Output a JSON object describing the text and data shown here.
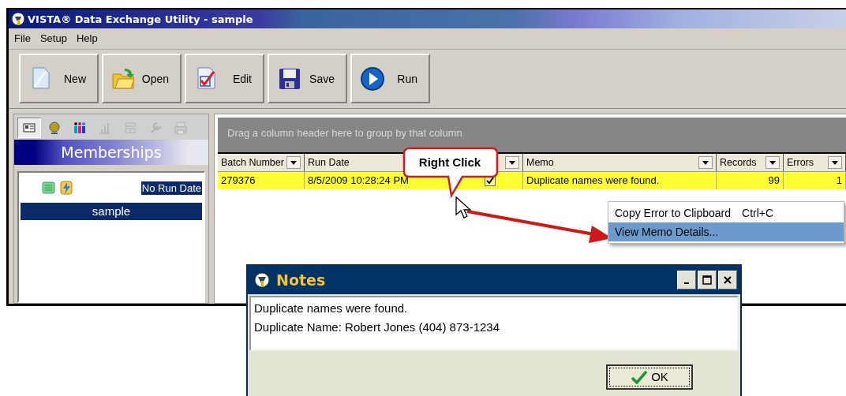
{
  "window": {
    "title": "VISTA® Data Exchange Utility - sample"
  },
  "menu": [
    "File",
    "Setup",
    "Help"
  ],
  "toolbar": [
    {
      "label": "New",
      "kind": "new"
    },
    {
      "label": "Open",
      "kind": "open"
    },
    {
      "label": "Edit",
      "kind": "edit"
    },
    {
      "label": "Save",
      "kind": "save"
    },
    {
      "label": "Run",
      "kind": "run"
    }
  ],
  "nav_tabs": [
    {
      "kind": "card",
      "selected": true,
      "disabled": false
    },
    {
      "kind": "head",
      "selected": false,
      "disabled": false
    },
    {
      "kind": "people",
      "selected": false,
      "disabled": false
    },
    {
      "kind": "chart",
      "selected": false,
      "disabled": true
    },
    {
      "kind": "grid",
      "selected": false,
      "disabled": true
    },
    {
      "kind": "tool",
      "selected": false,
      "disabled": true
    },
    {
      "kind": "printer",
      "selected": false,
      "disabled": true
    }
  ],
  "panel_title": "Memberships",
  "memberships": [
    {
      "kind": "status",
      "label": "No Run Date",
      "selected": true
    },
    {
      "kind": "name",
      "label": "sample",
      "selected": true
    }
  ],
  "grid": {
    "group_hint": "Drag a column header here to group by that column",
    "columns": [
      {
        "label": "Batch Number"
      },
      {
        "label": "Run Date"
      },
      {},
      {
        "label": "Memo"
      },
      {
        "label": "Records"
      },
      {
        "label": "Errors"
      }
    ],
    "rows": [
      {
        "selected": true,
        "batch": "279376",
        "run_date": "8/5/2009 10:28:24 PM",
        "checked": true,
        "memo": "Duplicate names were found.",
        "records": "99",
        "errors": "1"
      }
    ]
  },
  "callout": "Right Click",
  "context_menu": [
    {
      "label": "Copy Error to Clipboard",
      "shortcut": "Ctrl+C",
      "selected": false
    },
    {
      "label": "View Memo Details...",
      "selected": true
    }
  ],
  "notes_dialog": {
    "title": "Notes",
    "lines": [
      "Duplicate names were found.",
      "Duplicate Name: Robert Jones (404) 873-1234"
    ],
    "ok": "OK"
  }
}
